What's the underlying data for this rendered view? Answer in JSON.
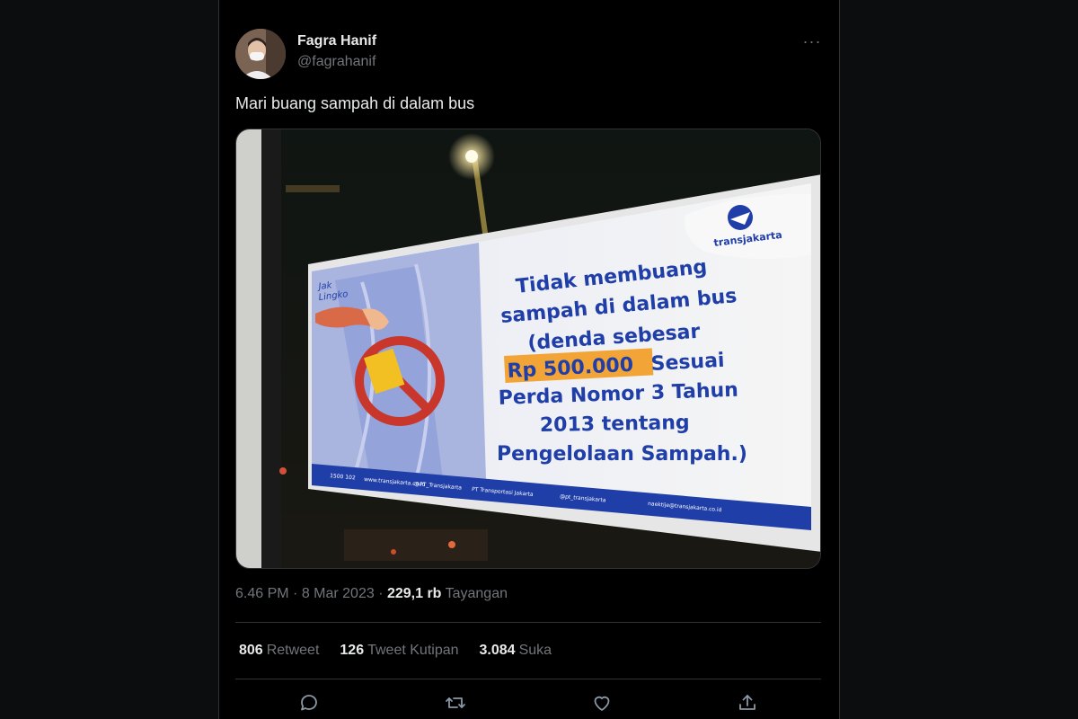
{
  "user": {
    "name": "Fagra Hanif",
    "handle": "@fagrahanif"
  },
  "tweet": {
    "text": "Mari buang sampah di dalam bus"
  },
  "sign": {
    "brand": "transjakarta",
    "sub_brand_line1": "Jak",
    "sub_brand_line2": "Lingko",
    "line1": "Tidak membuang",
    "line2": "sampah di dalam bus",
    "line3": "(denda sebesar",
    "amount": "Rp 500.000",
    "line4_rest": " Sesuai",
    "line5": "Perda Nomor 3 Tahun",
    "line6": "2013 tentang",
    "line7": "Pengelolaan Sampah.)",
    "footer_phone": "1500 102",
    "footer_web": "www.transjakarta.co.id",
    "footer_tw": "@PT_Transjakarta",
    "footer_fb": "PT Transportasi Jakarta",
    "footer_ig": "@pt_transjakarta",
    "footer_email": "naektije@transjakarta.co.id",
    "colors": {
      "blue": "#1f3ea8",
      "highlight": "#f2a536",
      "red": "#c8362c",
      "panel": "#f3f3f3"
    }
  },
  "meta": {
    "time": "6.46 PM",
    "sep1": " · ",
    "date": "8 Mar 2023",
    "sep2": " · ",
    "views_count": "229,1 rb",
    "views_label": " Tayangan"
  },
  "stats": {
    "retweets_count": "806",
    "retweets_label": "Retweet",
    "quotes_count": "126",
    "quotes_label": "Tweet Kutipan",
    "likes_count": "3.084",
    "likes_label": "Suka"
  },
  "actions": [
    "reply-icon",
    "retweet-icon",
    "like-icon",
    "share-icon"
  ],
  "more_label": "···"
}
